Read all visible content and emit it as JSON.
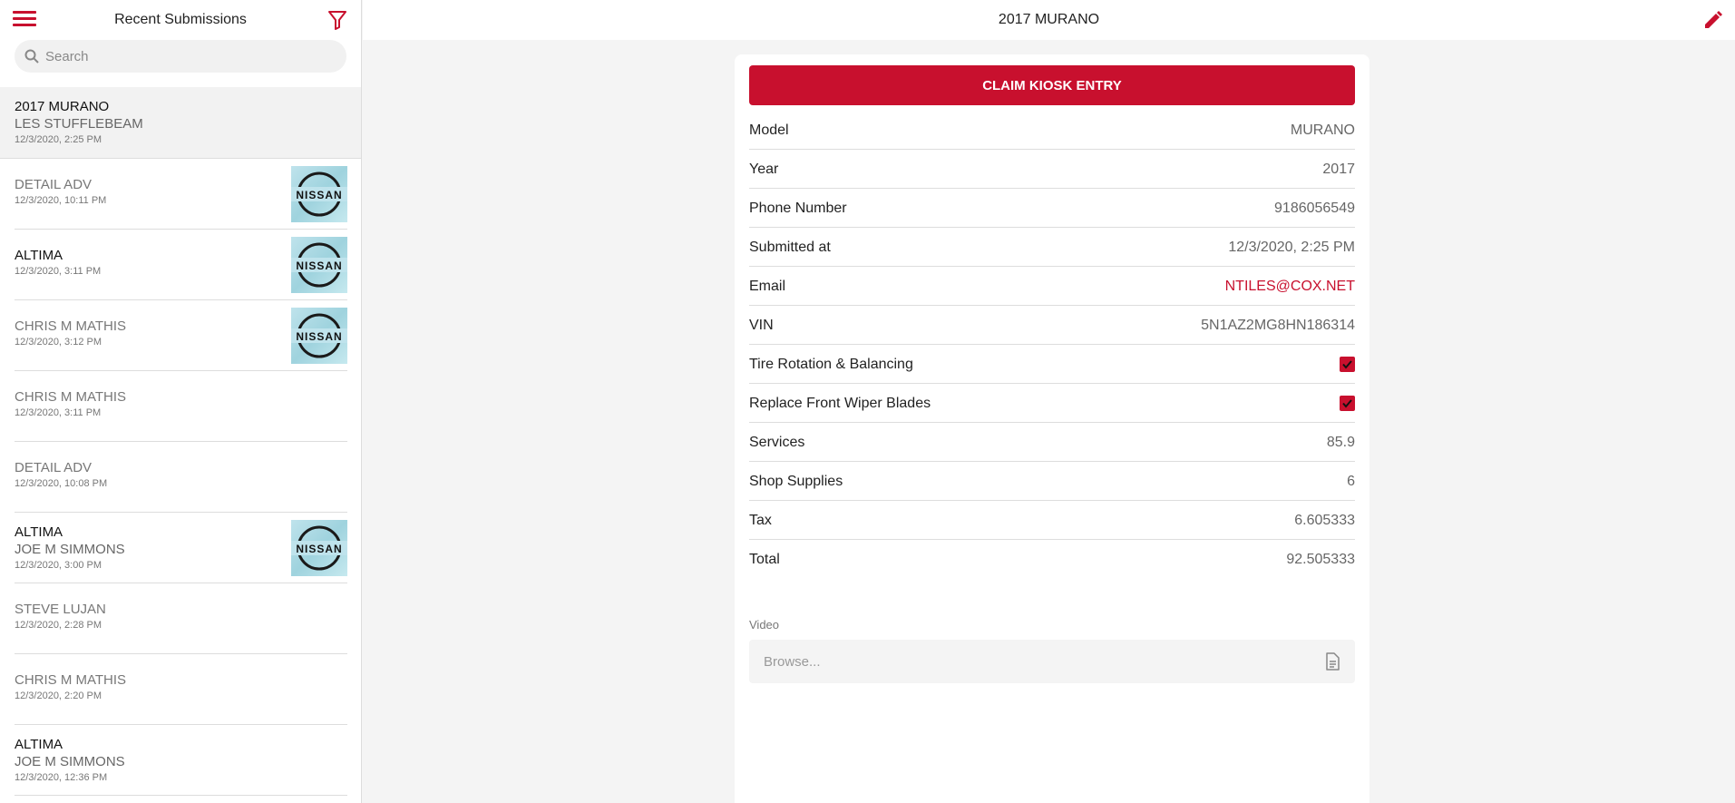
{
  "sidebar": {
    "title": "Recent Submissions",
    "search": {
      "placeholder": "Search",
      "value": ""
    },
    "items": [
      {
        "line1": "2017 MURANO",
        "line2": "LES STUFFLEBEAM",
        "time": "12/3/2020, 2:25 PM"
      },
      {
        "line1": "DETAIL ADV",
        "time": "12/3/2020, 10:11 PM"
      },
      {
        "line1": "ALTIMA",
        "time": "12/3/2020, 3:11 PM"
      },
      {
        "line1": "CHRIS M MATHIS",
        "time": "12/3/2020, 3:12 PM"
      },
      {
        "line1": "CHRIS M MATHIS",
        "time": "12/3/2020, 3:11 PM"
      },
      {
        "line1": "DETAIL ADV",
        "time": "12/3/2020, 10:08 PM"
      },
      {
        "line1": "ALTIMA",
        "line2": "JOE M SIMMONS",
        "time": "12/3/2020, 3:00 PM"
      },
      {
        "line1": "STEVE LUJAN",
        "time": "12/3/2020, 2:28 PM"
      },
      {
        "line1": "CHRIS M MATHIS",
        "time": "12/3/2020, 2:20 PM"
      },
      {
        "line1": "ALTIMA",
        "line2": "JOE M SIMMONS",
        "time": "12/3/2020, 12:36 PM"
      }
    ],
    "logo_text": "NISSAN"
  },
  "main": {
    "title": "2017 MURANO",
    "claim_label": "CLAIM KIOSK ENTRY",
    "fields": {
      "model": {
        "label": "Model",
        "value": "MURANO"
      },
      "year": {
        "label": "Year",
        "value": "2017"
      },
      "phone": {
        "label": "Phone Number",
        "value": "9186056549"
      },
      "submitted": {
        "label": "Submitted at",
        "value": "12/3/2020, 2:25 PM"
      },
      "email": {
        "label": "Email",
        "value": "NTILES@COX.NET"
      },
      "vin": {
        "label": "VIN",
        "value": "5N1AZ2MG8HN186314"
      },
      "tire": {
        "label": "Tire Rotation & Balancing",
        "checked": true
      },
      "wiper": {
        "label": "Replace Front Wiper Blades",
        "checked": true
      },
      "services": {
        "label": "Services",
        "value": "85.9"
      },
      "supplies": {
        "label": "Shop Supplies",
        "value": "6"
      },
      "tax": {
        "label": "Tax",
        "value": "6.605333"
      },
      "total": {
        "label": "Total",
        "value": "92.505333"
      }
    },
    "video": {
      "label": "Video",
      "placeholder": "Browse..."
    }
  },
  "colors": {
    "accent": "#c8102e"
  },
  "icons": {
    "menu": "menu-icon",
    "filter": "filter-icon",
    "search": "search-icon",
    "edit": "pencil-icon",
    "file": "document-icon",
    "check": "checkmark-icon"
  }
}
